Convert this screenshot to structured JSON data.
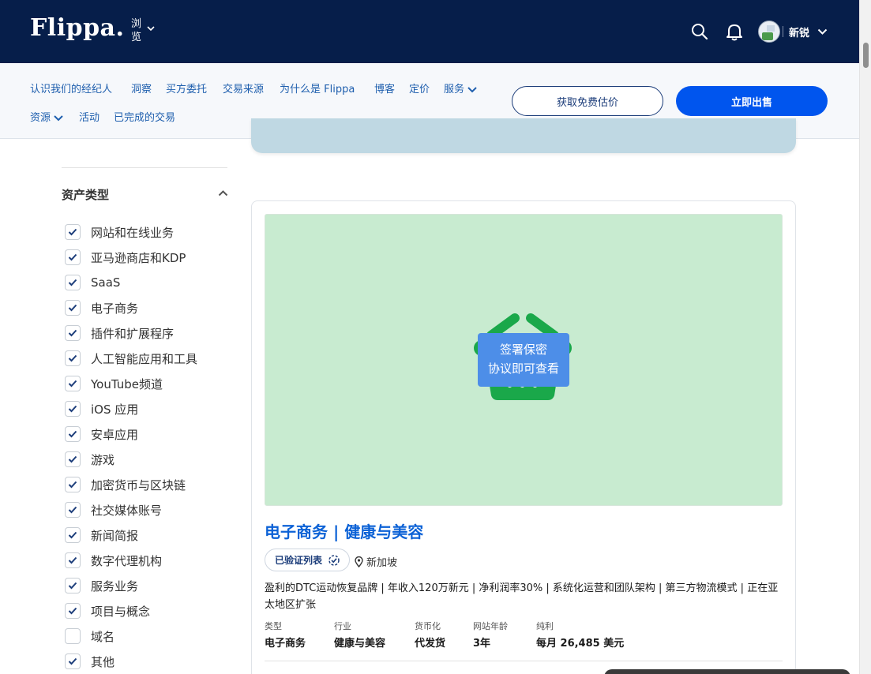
{
  "header": {
    "logo": "Flippa.",
    "browse_label": "浏览",
    "username": "新锐"
  },
  "subnav": {
    "links": [
      "认识我们的经纪人",
      "洞察",
      "买方委托",
      "交易来源",
      "为什么是 Flippa",
      "博客",
      "定价",
      "服务",
      "资源",
      "活动",
      "已完成的交易"
    ],
    "btn_estimate": "获取免费估价",
    "btn_sell": "立即出售"
  },
  "sidebar": {
    "section_title": "资产类型",
    "filters": [
      {
        "label": "网站和在线业务",
        "checked": true
      },
      {
        "label": "亚马逊商店和KDP",
        "checked": true
      },
      {
        "label": "SaaS",
        "checked": true
      },
      {
        "label": "电子商务",
        "checked": true
      },
      {
        "label": "插件和扩展程序",
        "checked": true
      },
      {
        "label": "人工智能应用和工具",
        "checked": true
      },
      {
        "label": "YouTube频道",
        "checked": true
      },
      {
        "label": "iOS 应用",
        "checked": true
      },
      {
        "label": "安卓应用",
        "checked": true
      },
      {
        "label": "游戏",
        "checked": true
      },
      {
        "label": "加密货币与区块链",
        "checked": true
      },
      {
        "label": "社交媒体账号",
        "checked": true
      },
      {
        "label": "新闻简报",
        "checked": true
      },
      {
        "label": "数字代理机构",
        "checked": true
      },
      {
        "label": "服务业务",
        "checked": true
      },
      {
        "label": "项目与概念",
        "checked": true
      },
      {
        "label": "域名",
        "checked": false
      },
      {
        "label": "其他",
        "checked": true
      }
    ]
  },
  "listing": {
    "nda_line1": "签署保密",
    "nda_line2": "协议即可查看",
    "title": "电子商务 | 健康与美容",
    "verified_label": "已验证列表",
    "location": "新加坡",
    "description": "盈利的DTC运动恢复品牌 | 年收入120万新元 | 净利润率30% | 系统化运营和团队架构 | 第三方物流模式 | 正在亚太地区扩张",
    "meta": [
      {
        "label": "类型",
        "value": "电子商务"
      },
      {
        "label": "行业",
        "value": "健康与美容"
      },
      {
        "label": "货币化",
        "value": "代发货"
      },
      {
        "label": "网站年龄",
        "value": "3年"
      },
      {
        "label": "纯利",
        "value": "每月 26,485 美元"
      }
    ]
  },
  "colors": {
    "navy": "#061e4a",
    "primary_blue": "#0055ee",
    "link_blue": "#1f5fae",
    "title_blue": "#0c62d6",
    "image_bg": "#c8ebd0",
    "basket_green": "#1aa84a",
    "nda_blue": "#4d8ee8"
  },
  "icons": {
    "search": "search-icon",
    "bell": "bell-icon",
    "chevron": "chevron-down-icon",
    "check": "check-icon",
    "basket": "basket-icon",
    "verified": "verified-badge-icon",
    "location": "location-pin-icon"
  }
}
